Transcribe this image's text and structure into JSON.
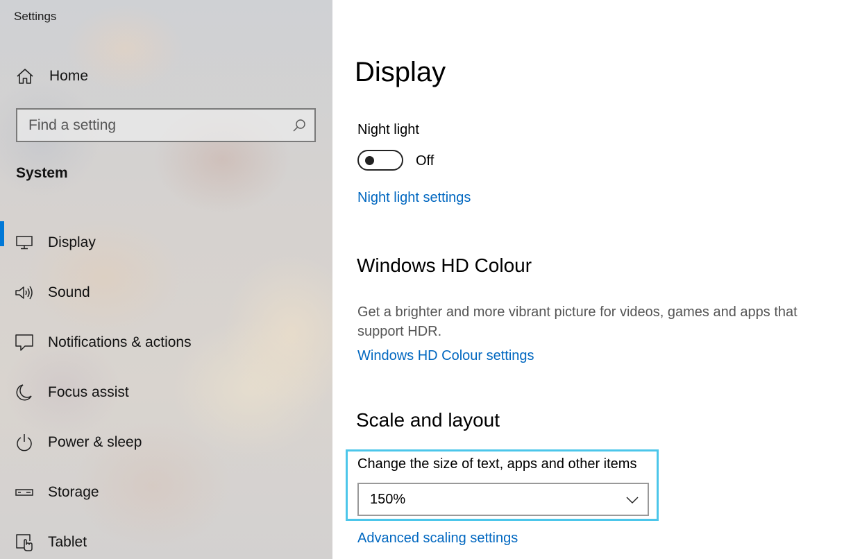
{
  "window": {
    "title": "Settings"
  },
  "sidebar": {
    "home_label": "Home",
    "search_placeholder": "Find a setting",
    "section_title": "System",
    "items": [
      {
        "label": "Display",
        "icon": "monitor-icon",
        "selected": true
      },
      {
        "label": "Sound",
        "icon": "speaker-icon",
        "selected": false
      },
      {
        "label": "Notifications & actions",
        "icon": "message-icon",
        "selected": false
      },
      {
        "label": "Focus assist",
        "icon": "moon-icon",
        "selected": false
      },
      {
        "label": "Power & sleep",
        "icon": "power-icon",
        "selected": false
      },
      {
        "label": "Storage",
        "icon": "drive-icon",
        "selected": false
      },
      {
        "label": "Tablet",
        "icon": "tablet-icon",
        "selected": false
      }
    ]
  },
  "main": {
    "title": "Display",
    "night_light": {
      "label": "Night light",
      "state": "Off",
      "settings_link": "Night light settings"
    },
    "hdr": {
      "heading": "Windows HD Colour",
      "description": "Get a brighter and more vibrant picture for videos, games and apps that support HDR.",
      "settings_link": "Windows HD Colour settings"
    },
    "scale": {
      "heading": "Scale and layout",
      "label": "Change the size of text, apps and other items",
      "value": "150%",
      "advanced_link": "Advanced scaling settings"
    }
  },
  "colors": {
    "accent": "#0078d7",
    "link": "#0067c0",
    "focus_outline": "#4cc6ea"
  }
}
